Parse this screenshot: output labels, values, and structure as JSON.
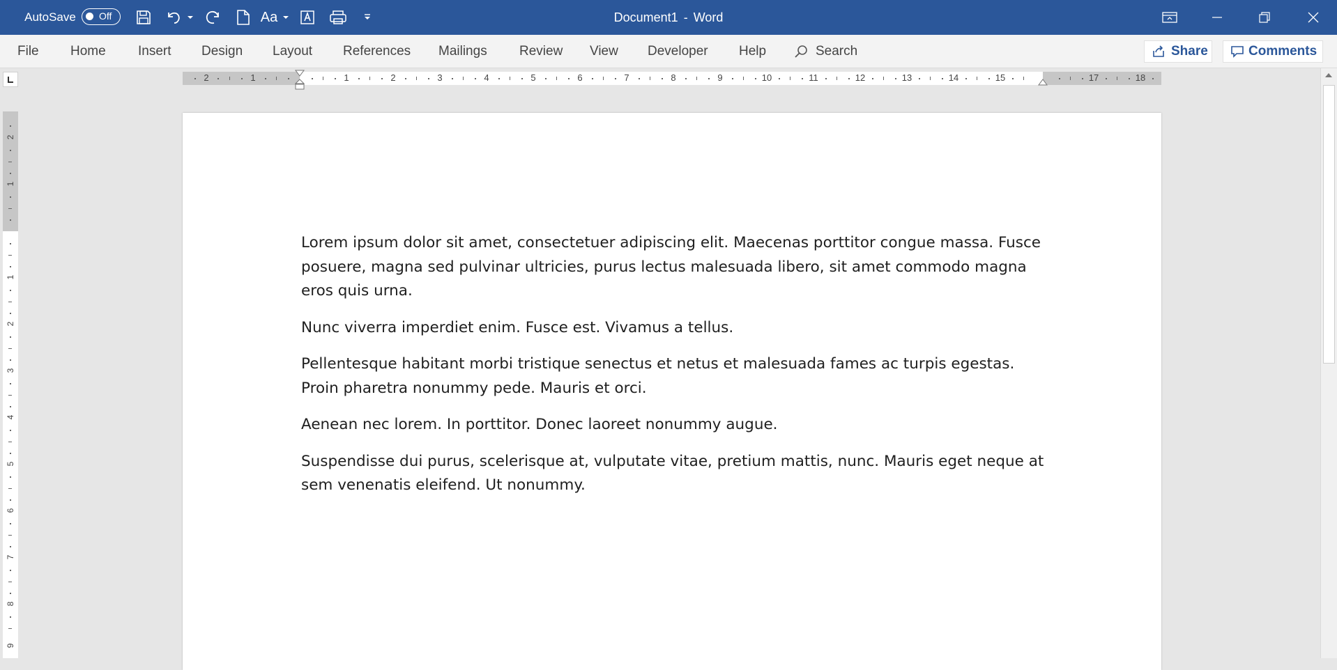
{
  "titlebar": {
    "autosave_label": "AutoSave",
    "autosave_state": "Off",
    "font_case_label": "Aa",
    "document_name": "Document1",
    "title_separator": "-",
    "app_name": "Word"
  },
  "menu": {
    "items": [
      "File",
      "Home",
      "Insert",
      "Design",
      "Layout",
      "References",
      "Mailings",
      "Review",
      "View",
      "Developer",
      "Help"
    ],
    "search_label": "Search",
    "share_label": "Share",
    "comments_label": "Comments"
  },
  "ruler": {
    "left_numbers": [
      "2",
      "1"
    ],
    "right_numbers": [
      "1",
      "2",
      "3",
      "4",
      "5",
      "6",
      "7",
      "8",
      "9",
      "10",
      "11",
      "12",
      "13",
      "14",
      "15",
      "17",
      "18"
    ],
    "vertical_numbers": [
      "2",
      "1",
      "1",
      "2",
      "3",
      "4",
      "5",
      "6",
      "7",
      "8",
      "9"
    ]
  },
  "document": {
    "paragraphs": [
      "Lorem ipsum dolor sit amet, consectetuer adipiscing elit. Maecenas porttitor congue massa. Fusce posuere, magna sed pulvinar ultricies, purus lectus malesuada libero, sit amet commodo magna eros quis urna.",
      "Nunc viverra imperdiet enim. Fusce est. Vivamus a tellus.",
      "Pellentesque habitant morbi tristique senectus et netus et malesuada fames ac turpis egestas. Proin pharetra nonummy pede. Mauris et orci.",
      "Aenean nec lorem. In porttitor. Donec laoreet nonummy augue.",
      "Suspendisse dui purus, scelerisque at, vulputate vitae, pretium mattis, nunc. Mauris eget neque at sem venenatis eleifend. Ut nonummy."
    ]
  },
  "colors": {
    "titlebar_bg": "#2b579a",
    "accent": "#2b579a",
    "menubar_bg": "#f3f3f3",
    "workspace_bg": "#e6e6e6"
  }
}
